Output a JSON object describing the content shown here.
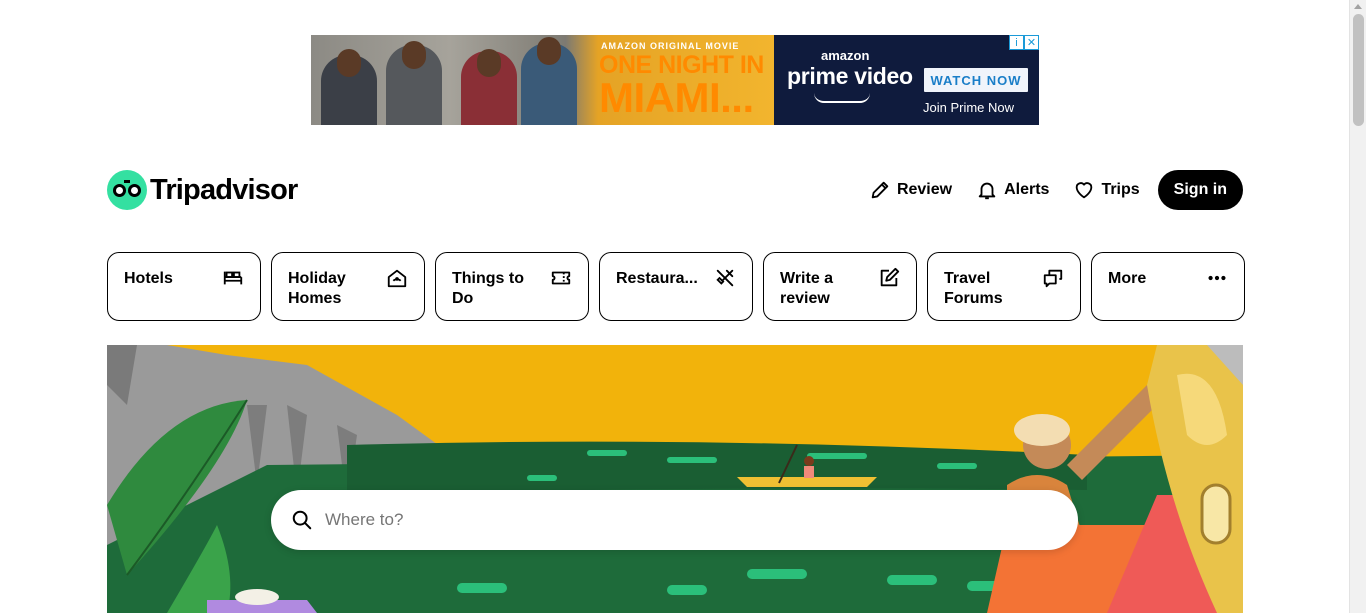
{
  "ad": {
    "kicker": "AMAZON ORIGINAL MOVIE",
    "title_line1": "ONE NIGHT IN",
    "title_line2": "MIAMI...",
    "brand": "amazon",
    "product": "prime video",
    "cta": "WATCH NOW",
    "join": "Join Prime Now",
    "info_icon": "info-icon",
    "close_icon": "close-icon"
  },
  "header": {
    "logo_text": "Tripadvisor",
    "nav": [
      {
        "label": "Review",
        "icon": "pencil-icon"
      },
      {
        "label": "Alerts",
        "icon": "bell-icon"
      },
      {
        "label": "Trips",
        "icon": "heart-icon"
      }
    ],
    "signin_label": "Sign in"
  },
  "categories": [
    {
      "label": "Hotels",
      "icon": "bed-icon"
    },
    {
      "label": "Holiday Homes",
      "icon": "house-icon"
    },
    {
      "label": "Things to Do",
      "icon": "ticket-icon"
    },
    {
      "label": "Restaura...",
      "icon": "fork-knife-icon"
    },
    {
      "label": "Write a review",
      "icon": "edit-icon"
    },
    {
      "label": "Travel Forums",
      "icon": "chat-icon"
    },
    {
      "label": "More",
      "icon": "more-dots-icon"
    }
  ],
  "search": {
    "placeholder": "Where to?",
    "value": ""
  },
  "colors": {
    "brand_green": "#34e0a1",
    "hero_yellow": "#f2b30b",
    "hero_green": "#1e6b3a"
  }
}
